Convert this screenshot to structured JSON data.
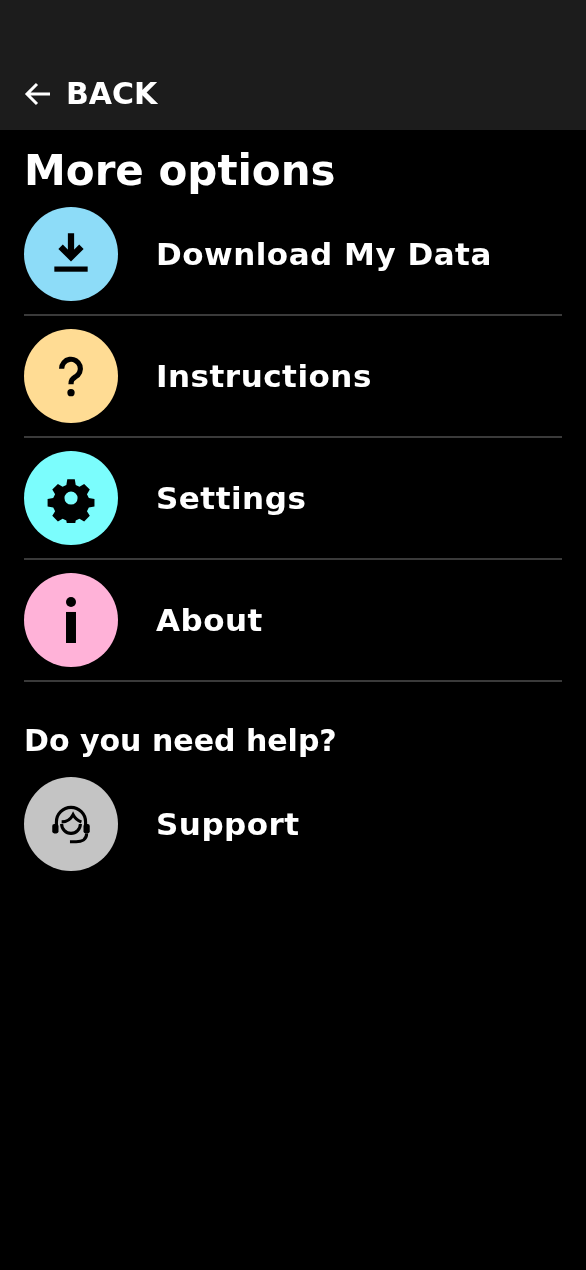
{
  "header": {
    "back_label": "BACK"
  },
  "title": "More options",
  "options": [
    {
      "label": "Download My Data",
      "kind": "download",
      "color": "#8ddcf8"
    },
    {
      "label": "Instructions",
      "kind": "question",
      "color": "#ffdc94"
    },
    {
      "label": "Settings",
      "kind": "gear",
      "color": "#7bfdfd"
    },
    {
      "label": "About",
      "kind": "info",
      "color": "#ffb2d8"
    }
  ],
  "help": {
    "heading": "Do you need help?",
    "items": [
      {
        "label": "Support",
        "kind": "headset",
        "color": "#c4c4c4"
      }
    ]
  }
}
